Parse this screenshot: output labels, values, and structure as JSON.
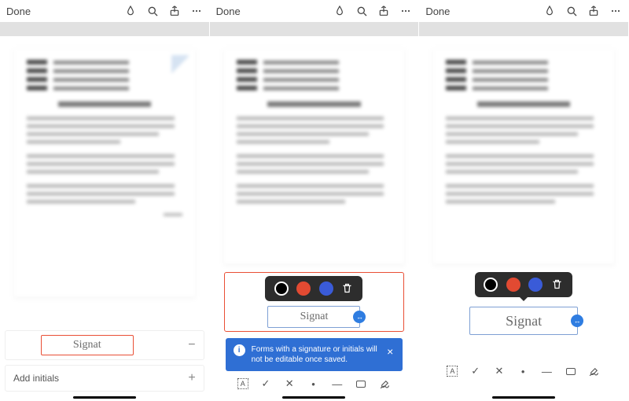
{
  "topbar": {
    "done_label": "Done"
  },
  "signature_text": "Signat",
  "sheet": {
    "add_initials_label": "Add initials"
  },
  "banner": {
    "text": "Forms with a signature or initials will not be editable once saved."
  },
  "colors": {
    "black": "#000000",
    "red": "#e24a32",
    "blue": "#3a5bd8"
  },
  "tools": [
    "text-box",
    "checkmark",
    "cross",
    "dot",
    "line",
    "rounded-rect",
    "pen"
  ]
}
